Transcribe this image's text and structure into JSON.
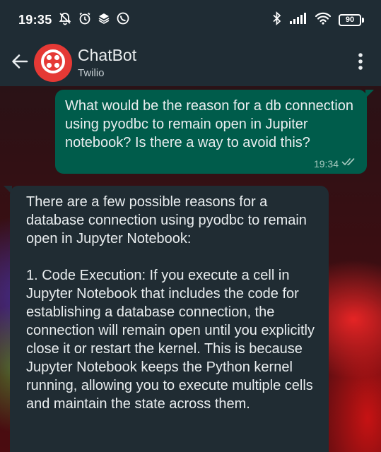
{
  "status_bar": {
    "time": "19:35",
    "battery": "90",
    "left_icons": [
      "bell-off-icon",
      "alarm-icon",
      "stack-icon",
      "whatsapp-icon"
    ],
    "right_icons": [
      "bluetooth-icon",
      "signal-icon",
      "wifi-icon",
      "battery-icon"
    ]
  },
  "header": {
    "title": "ChatBot",
    "subtitle": "Twilio",
    "avatar_color": "#e53935",
    "icons": [
      "back-arrow-icon",
      "twilio-logo-icon",
      "more-vertical-icon"
    ]
  },
  "messages": [
    {
      "direction": "outgoing",
      "text": "What would be the reason for a db connection using pyodbc to remain open in Jupiter notebook? Is there a way to avoid this?",
      "time": "19:34",
      "status": "read"
    },
    {
      "direction": "incoming",
      "text": "There are a few possible reasons for a database connection using pyodbc to remain open in Jupyter Notebook:\n\n1. Code Execution: If you execute a cell in Jupyter Notebook that includes the code for establishing a database connection, the connection will remain open until you explicitly close it or restart the kernel. This is because Jupyter Notebook keeps the Python kernel running, allowing you to execute multiple cells and maintain the state across them."
    }
  ],
  "colors": {
    "header_bg": "#1f2c34",
    "outgoing_bubble": "#005c4b",
    "incoming_bubble": "#202c33",
    "read_ticks": "#53bdeb"
  }
}
